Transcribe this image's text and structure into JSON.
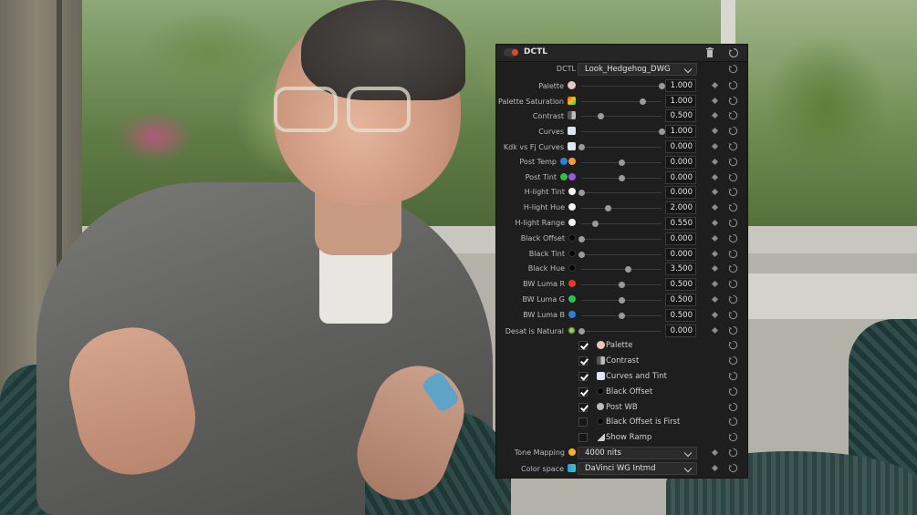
{
  "panel": {
    "title": "DCTL",
    "dctl_label": "DCTL",
    "dctl_value": "Look_Hedgehog_DWG",
    "sliders": [
      {
        "label": "Palette",
        "icon": "palette-icon",
        "value": "1.000",
        "pos": 1.0
      },
      {
        "label": "Palette Saturation",
        "icon": "rainbow-icon",
        "value": "1.000",
        "pos": 0.76
      },
      {
        "label": "Contrast",
        "icon": "contrast-icon",
        "value": "0.500",
        "pos": 0.24
      },
      {
        "label": "Curves",
        "icon": "curves-icon",
        "value": "1.000",
        "pos": 1.0
      },
      {
        "label": "Kdk vs Fj Curves",
        "icon": "curves-icon",
        "value": "0.000",
        "pos": 0.0
      },
      {
        "label": "Post Temp",
        "icon": "temp-hearts-icon",
        "value": "0.000",
        "pos": 0.5
      },
      {
        "label": "Post Tint",
        "icon": "tint-hearts-icon",
        "value": "0.000",
        "pos": 0.5
      },
      {
        "label": "H-light Tint",
        "icon": "white-dot-icon",
        "value": "0.000",
        "pos": 0.0
      },
      {
        "label": "H-light Hue",
        "icon": "white-dot-icon",
        "value": "2.000",
        "pos": 0.33
      },
      {
        "label": "H-light Range",
        "icon": "white-dot-icon",
        "value": "0.550",
        "pos": 0.17
      },
      {
        "label": "Black Offset",
        "icon": "black-dot-icon",
        "value": "0.000",
        "pos": 0.0
      },
      {
        "label": "Black Tint",
        "icon": "black-dot-icon",
        "value": "0.000",
        "pos": 0.0
      },
      {
        "label": "Black Hue",
        "icon": "black-dot-icon",
        "value": "3.500",
        "pos": 0.58
      },
      {
        "label": "BW Luma R",
        "icon": "red-dot-icon",
        "value": "0.500",
        "pos": 0.5
      },
      {
        "label": "BW Luma G",
        "icon": "green-dot-icon",
        "value": "0.500",
        "pos": 0.5
      },
      {
        "label": "BW Luma B",
        "icon": "blue-dot-icon",
        "value": "0.500",
        "pos": 0.5
      },
      {
        "label": "Desat is Natural",
        "icon": "sparkle-icon",
        "value": "0.000",
        "pos": 0.0
      }
    ],
    "checkboxes": [
      {
        "label": "Palette",
        "checked": true,
        "icon": "palette-icon"
      },
      {
        "label": "Contrast",
        "checked": true,
        "icon": "contrast-icon"
      },
      {
        "label": "Curves and Tint",
        "checked": true,
        "icon": "curves-icon"
      },
      {
        "label": "Black Offset",
        "checked": true,
        "icon": "black-dot-icon"
      },
      {
        "label": "Post WB",
        "checked": true,
        "icon": "heart-icon"
      },
      {
        "label": "Black Offset is First",
        "checked": false,
        "icon": "black-dot-icon"
      },
      {
        "label": "Show Ramp",
        "checked": false,
        "icon": "ramp-icon"
      }
    ],
    "tone_mapping_label": "Tone Mapping",
    "tone_mapping_value": "4000 nits",
    "color_space_label": "Color space",
    "color_space_value": "DaVinci WG Intmd"
  },
  "colors": {
    "panel_bg": "#1e1e1e",
    "toggle_on": "#e8442e",
    "red": "#e23b2e",
    "green": "#2fbf4f",
    "blue": "#2f7fd6"
  }
}
